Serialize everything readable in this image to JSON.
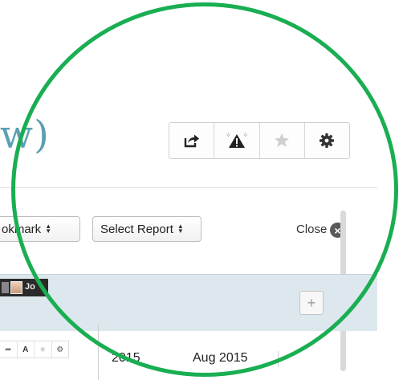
{
  "page": {
    "title_fragment": "w)"
  },
  "toolbar": {
    "buttons": [
      {
        "name": "share",
        "icon": "share-arrow-icon"
      },
      {
        "name": "alert",
        "icon": "warning-triangle-icon"
      },
      {
        "name": "favorite",
        "icon": "star-icon"
      },
      {
        "name": "settings",
        "icon": "gear-icon"
      }
    ]
  },
  "controls": {
    "bookmark_select": "okmark",
    "report_select": "Select Report",
    "close_label": "Close",
    "close_icon": "close-circle-icon"
  },
  "user_bar": {
    "user_fragment": "Jo"
  },
  "panel": {
    "add_label": "+"
  },
  "mini_toolbar": {
    "alert_glyph": "A"
  },
  "timeline": {
    "month_a": "2015",
    "month_b": "Aug 2015"
  },
  "colors": {
    "ring": "#1aae52",
    "title": "#5aa0b3",
    "band": "#dde7ee"
  }
}
